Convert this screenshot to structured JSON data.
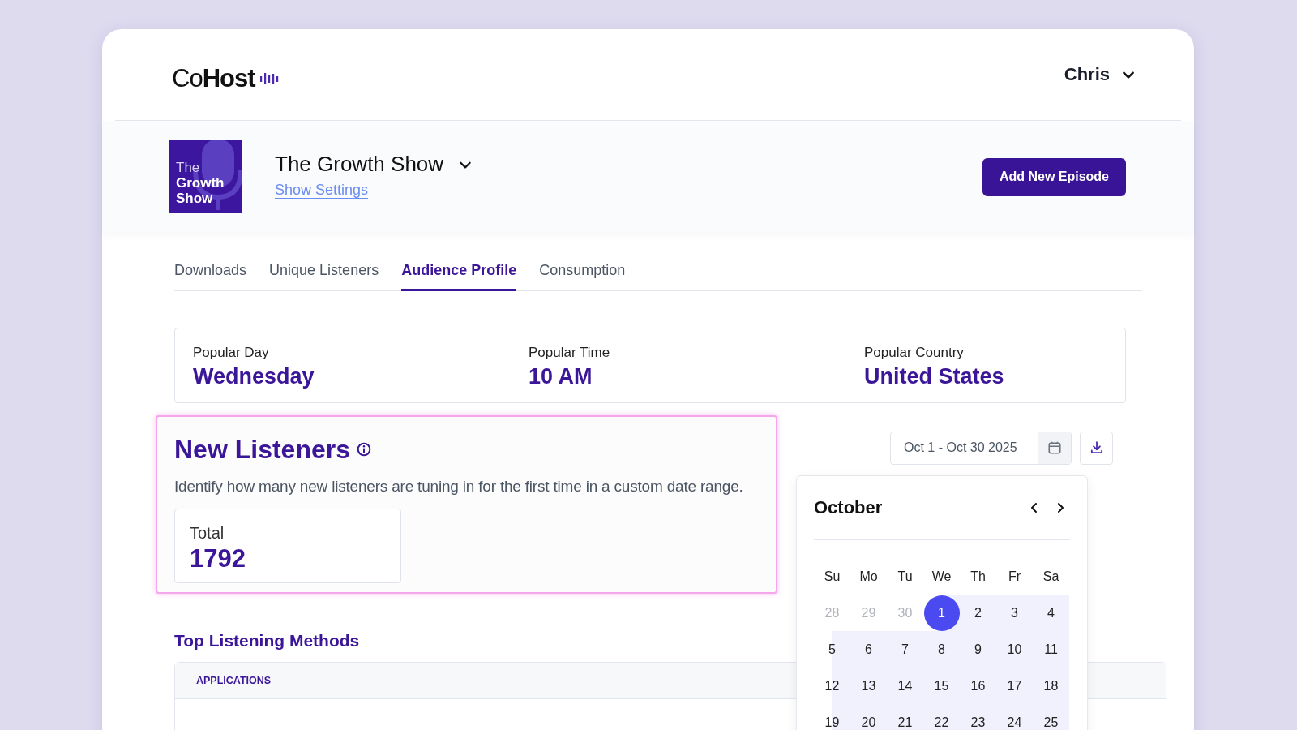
{
  "header": {
    "logo": "Co**Host**",
    "user": "Chris"
  },
  "show": {
    "cover_lines": [
      {
        "text": "The",
        "bold": false
      },
      {
        "text": "Growth",
        "bold": true
      },
      {
        "text": "Show",
        "bold": true
      }
    ],
    "title": "The Growth Show",
    "settings_link": "Show Settings",
    "add_button": "Add New Episode"
  },
  "tabs": [
    {
      "label": "Downloads",
      "selected": false
    },
    {
      "label": "Unique Listeners",
      "selected": false
    },
    {
      "label": "Audience Profile",
      "selected": true
    },
    {
      "label": "Consumption",
      "selected": false
    }
  ],
  "stats": [
    {
      "label": "Popular Day",
      "value": "Wednesday"
    },
    {
      "label": "Popular Time",
      "value": "10 AM"
    },
    {
      "label": "Popular Country",
      "value": "United States"
    }
  ],
  "new_listeners": {
    "title": "New Listeners",
    "description": "Identify how many new listeners are tuning in for the first time in a custom date range.",
    "total_label": "Total",
    "total_value": "1792"
  },
  "date_range": {
    "value": "Oct 1 - Oct 30 2025"
  },
  "calendar": {
    "month": "October",
    "weekdays": [
      "Su",
      "Mo",
      "Tu",
      "We",
      "Th",
      "Fr",
      "Sa"
    ],
    "days": [
      {
        "label": "28",
        "muted": true,
        "selected": false,
        "in_range": false
      },
      {
        "label": "29",
        "muted": true,
        "selected": false,
        "in_range": false
      },
      {
        "label": "30",
        "muted": true,
        "selected": false,
        "in_range": false
      },
      {
        "label": "1",
        "muted": false,
        "selected": true,
        "in_range": true
      },
      {
        "label": "2",
        "muted": false,
        "selected": false,
        "in_range": true
      },
      {
        "label": "3",
        "muted": false,
        "selected": false,
        "in_range": true
      },
      {
        "label": "4",
        "muted": false,
        "selected": false,
        "in_range": true
      },
      {
        "label": "5",
        "muted": false,
        "selected": false,
        "in_range": true
      },
      {
        "label": "6",
        "muted": false,
        "selected": false,
        "in_range": true
      },
      {
        "label": "7",
        "muted": false,
        "selected": false,
        "in_range": true
      },
      {
        "label": "8",
        "muted": false,
        "selected": false,
        "in_range": true
      },
      {
        "label": "9",
        "muted": false,
        "selected": false,
        "in_range": true
      },
      {
        "label": "10",
        "muted": false,
        "selected": false,
        "in_range": true
      },
      {
        "label": "11",
        "muted": false,
        "selected": false,
        "in_range": true
      },
      {
        "label": "12",
        "muted": false,
        "selected": false,
        "in_range": true
      },
      {
        "label": "13",
        "muted": false,
        "selected": false,
        "in_range": true
      },
      {
        "label": "14",
        "muted": false,
        "selected": false,
        "in_range": true
      },
      {
        "label": "15",
        "muted": false,
        "selected": false,
        "in_range": true
      },
      {
        "label": "16",
        "muted": false,
        "selected": false,
        "in_range": true
      },
      {
        "label": "17",
        "muted": false,
        "selected": false,
        "in_range": true
      },
      {
        "label": "18",
        "muted": false,
        "selected": false,
        "in_range": true
      },
      {
        "label": "19",
        "muted": false,
        "selected": false,
        "in_range": true
      },
      {
        "label": "20",
        "muted": false,
        "selected": false,
        "in_range": true
      },
      {
        "label": "21",
        "muted": false,
        "selected": false,
        "in_range": true
      },
      {
        "label": "22",
        "muted": false,
        "selected": false,
        "in_range": true
      },
      {
        "label": "23",
        "muted": false,
        "selected": false,
        "in_range": true
      },
      {
        "label": "24",
        "muted": false,
        "selected": false,
        "in_range": true
      },
      {
        "label": "25",
        "muted": false,
        "selected": false,
        "in_range": true
      }
    ]
  },
  "top_methods": {
    "title": "Top Listening Methods",
    "columns": [
      "APPLICATIONS"
    ]
  }
}
